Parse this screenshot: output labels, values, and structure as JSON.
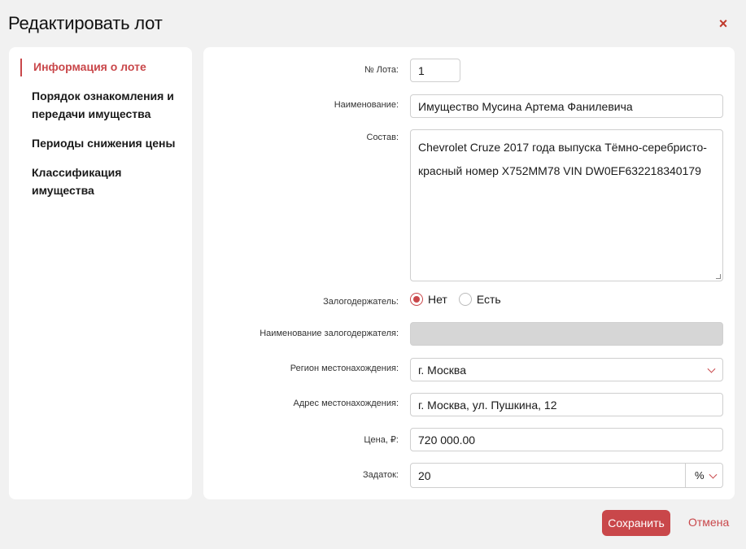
{
  "modal": {
    "title": "Редактировать лот",
    "close_glyph": "×"
  },
  "sidebar": {
    "items": [
      {
        "label": "Информация о лоте",
        "active": true
      },
      {
        "label": "Порядок ознакомления и передачи имущества",
        "active": false
      },
      {
        "label": "Периоды снижения цены",
        "active": false
      },
      {
        "label": "Классификация имущества",
        "active": false
      }
    ]
  },
  "form": {
    "lot_number": {
      "label": "№ Лота:",
      "value": "1"
    },
    "name": {
      "label": "Наименование:",
      "value": "Имущество Мусина Артема Фанилевича"
    },
    "composition": {
      "label": "Состав:",
      "value": "Chevrolet Cruze 2017 года выпуска Тёмно-серебристо-красный номер Х752ММ78 VIN DW0EF632218340179"
    },
    "pledgeholder": {
      "label": "Залогодержатель:",
      "options": [
        "Нет",
        "Есть"
      ],
      "selected": "Нет"
    },
    "pledgeholder_name": {
      "label": "Наименование залогодержателя:",
      "value": ""
    },
    "region": {
      "label": "Регион местонахождения:",
      "value": "г. Москва"
    },
    "address": {
      "label": "Адрес местонахождения:",
      "value": "г. Москва, ул. Пушкина, 12"
    },
    "price": {
      "label": "Цена, ₽:",
      "value": "720 000.00"
    },
    "deposit": {
      "label": "Задаток:",
      "value": "20",
      "unit": "%"
    }
  },
  "footer": {
    "save_label": "Сохранить",
    "cancel_label": "Отмена"
  },
  "colors": {
    "accent": "#c9474a",
    "background": "#f1f1f1",
    "panel": "#ffffff",
    "disabled_field": "#d6d6d6"
  }
}
